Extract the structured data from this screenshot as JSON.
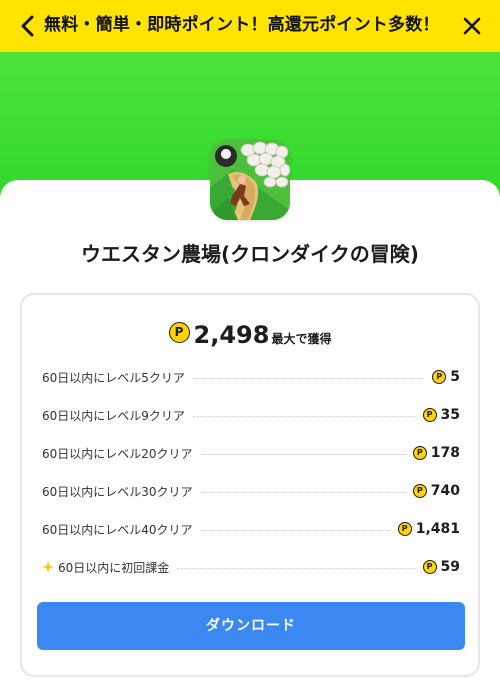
{
  "header": {
    "title": "無料・簡単・即時ポイント！高還元ポイント多数！"
  },
  "app": {
    "name": "ウエスタン農場(クロンダイクの冒険)",
    "icon": "klondike-farm-app-icon"
  },
  "reward": {
    "coin_symbol": "P",
    "total": "2,498",
    "total_suffix": "最大で獲得",
    "tasks": [
      {
        "label": "60日以内にレベル5クリア",
        "points": "5"
      },
      {
        "label": "60日以内にレベル9クリア",
        "points": "35"
      },
      {
        "label": "60日以内にレベル20クリア",
        "points": "178"
      },
      {
        "label": "60日以内にレベル30クリア",
        "points": "740"
      },
      {
        "label": "60日以内にレベル40クリア",
        "points": "1,481"
      },
      {
        "label": "60日以内に初回課金",
        "points": "59",
        "icon": "sparkle-icon"
      }
    ]
  },
  "actions": {
    "download_label": "ダウンロード"
  },
  "colors": {
    "header_bg": "#ffe400",
    "hero_green": "#3ddc30",
    "coin_yellow": "#ffd400",
    "button_blue": "#3b88f2"
  }
}
